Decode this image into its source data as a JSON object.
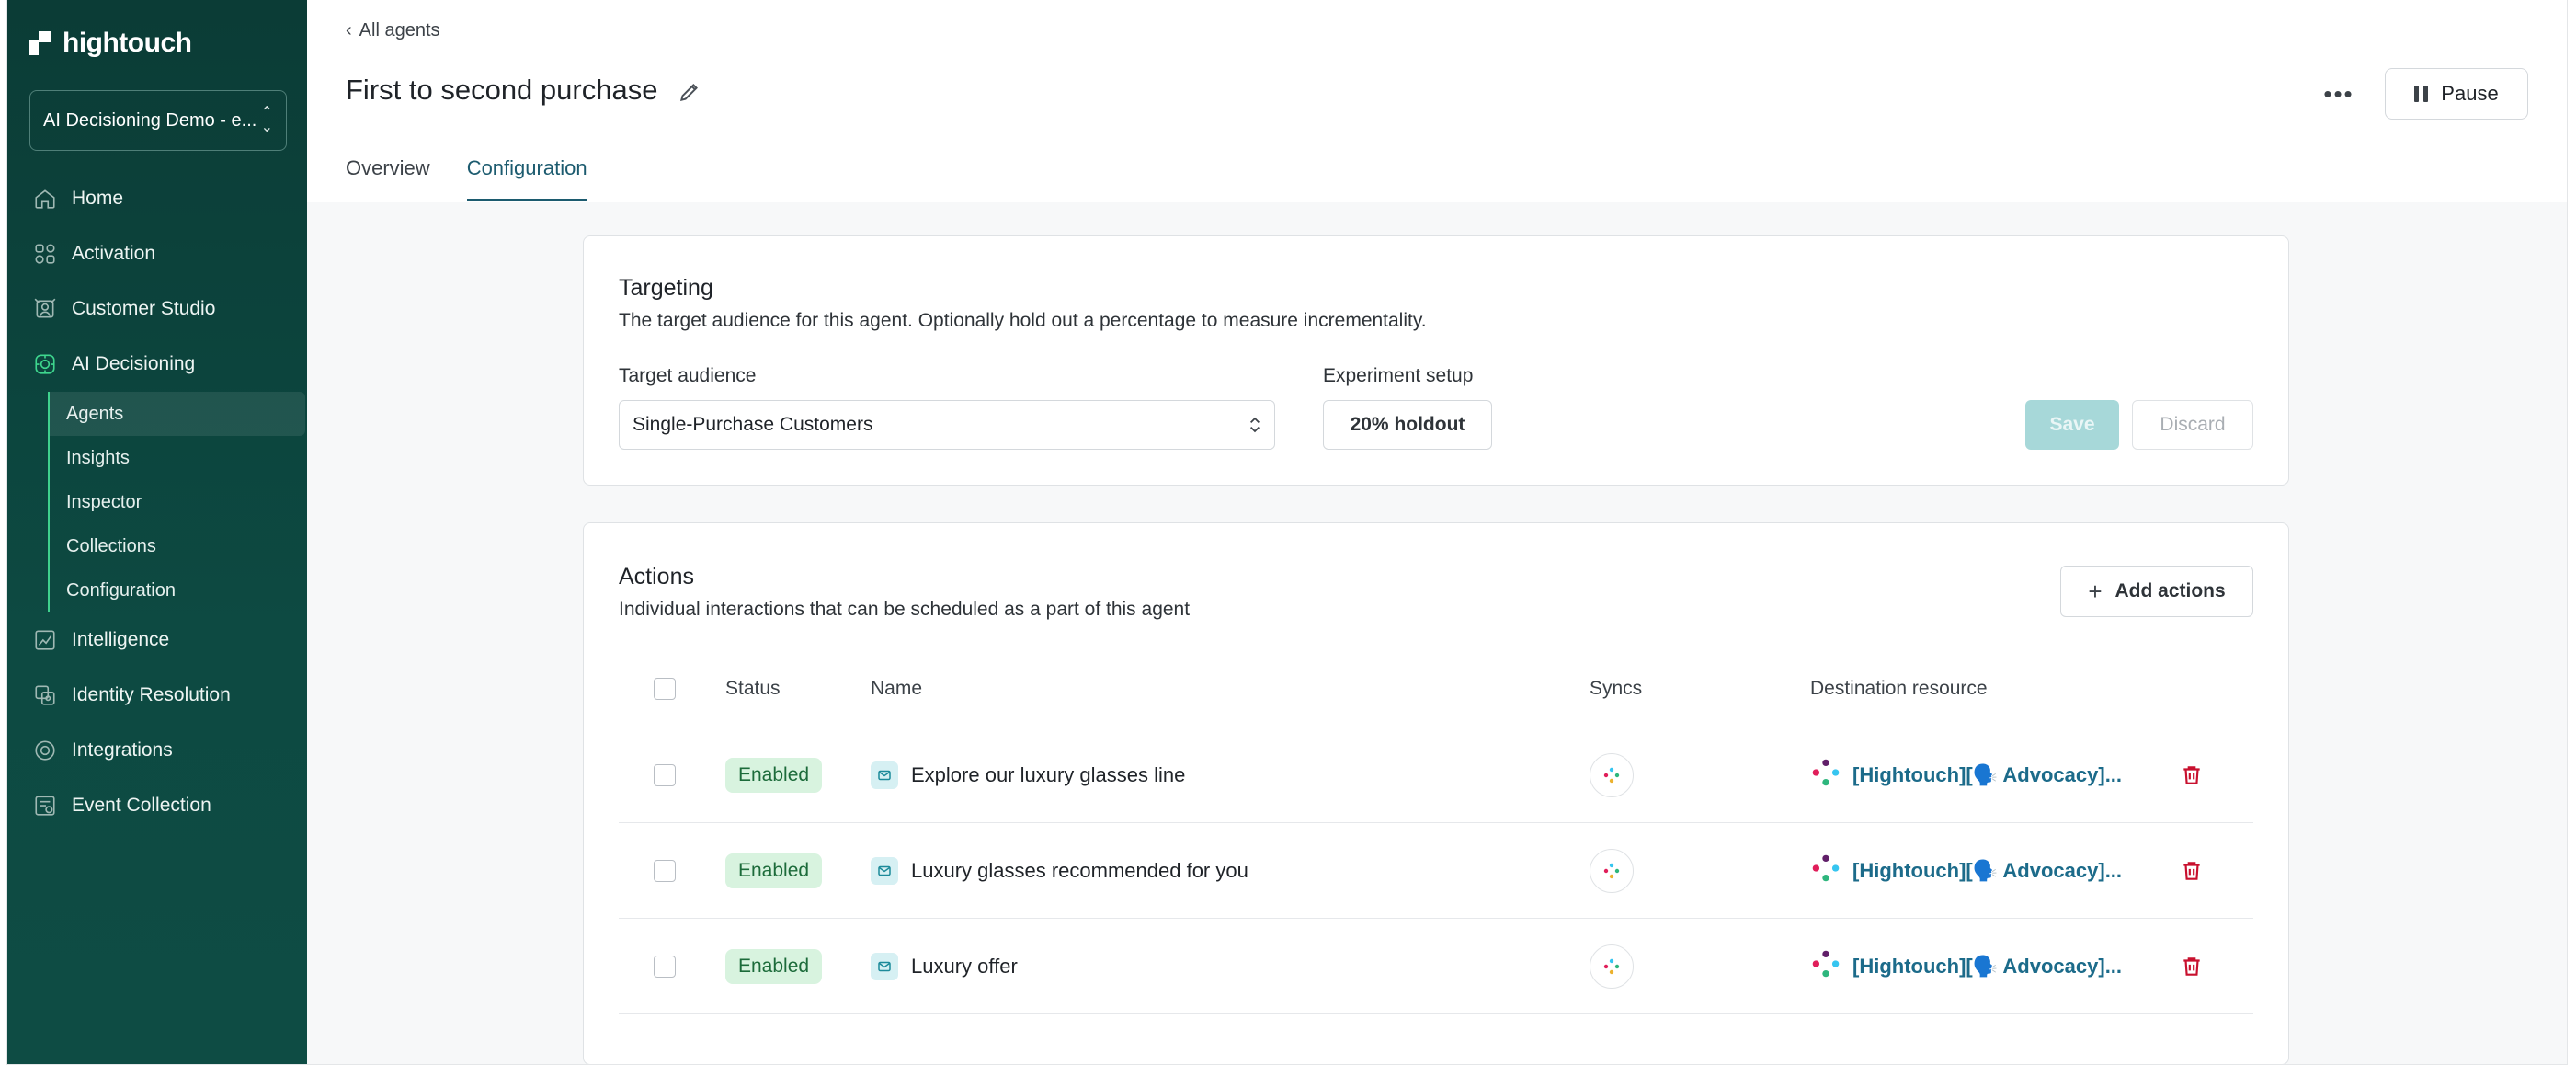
{
  "sidebar": {
    "brand": "hightouch",
    "workspace": "AI Decisioning Demo - e...",
    "items": [
      {
        "label": "Home",
        "icon": "home-icon"
      },
      {
        "label": "Activation",
        "icon": "activation-icon"
      },
      {
        "label": "Customer Studio",
        "icon": "customer-studio-icon"
      },
      {
        "label": "AI Decisioning",
        "icon": "ai-decisioning-icon"
      },
      {
        "label": "Intelligence",
        "icon": "intelligence-icon"
      },
      {
        "label": "Identity Resolution",
        "icon": "identity-resolution-icon"
      },
      {
        "label": "Integrations",
        "icon": "integrations-icon"
      },
      {
        "label": "Event Collection",
        "icon": "event-collection-icon"
      }
    ],
    "sub_items": [
      {
        "label": "Agents"
      },
      {
        "label": "Insights"
      },
      {
        "label": "Inspector"
      },
      {
        "label": "Collections"
      },
      {
        "label": "Configuration"
      }
    ],
    "accent": "#3ed68e"
  },
  "header": {
    "back_label": "All agents",
    "title": "First to second purchase",
    "tabs": [
      {
        "label": "Overview"
      },
      {
        "label": "Configuration"
      }
    ],
    "pause_label": "Pause"
  },
  "targeting": {
    "title": "Targeting",
    "description": "The target audience for this agent. Optionally hold out a percentage to measure incrementality.",
    "audience_label": "Target audience",
    "audience_value": "Single-Purchase Customers",
    "experiment_label": "Experiment setup",
    "experiment_value": "20% holdout",
    "save_label": "Save",
    "discard_label": "Discard"
  },
  "actions": {
    "title": "Actions",
    "description": "Individual interactions that can be scheduled as a part of this agent",
    "add_label": "Add actions",
    "columns": {
      "status": "Status",
      "name": "Name",
      "syncs": "Syncs",
      "destination": "Destination resource"
    },
    "rows": [
      {
        "status": "Enabled",
        "name": "Explore our luxury glasses line",
        "destination": "[Hightouch][🗣️ Advocacy]..."
      },
      {
        "status": "Enabled",
        "name": "Luxury glasses recommended for you",
        "destination": "[Hightouch][🗣️ Advocacy]..."
      },
      {
        "status": "Enabled",
        "name": "Luxury offer",
        "destination": "[Hightouch][🗣️ Advocacy]..."
      }
    ]
  }
}
